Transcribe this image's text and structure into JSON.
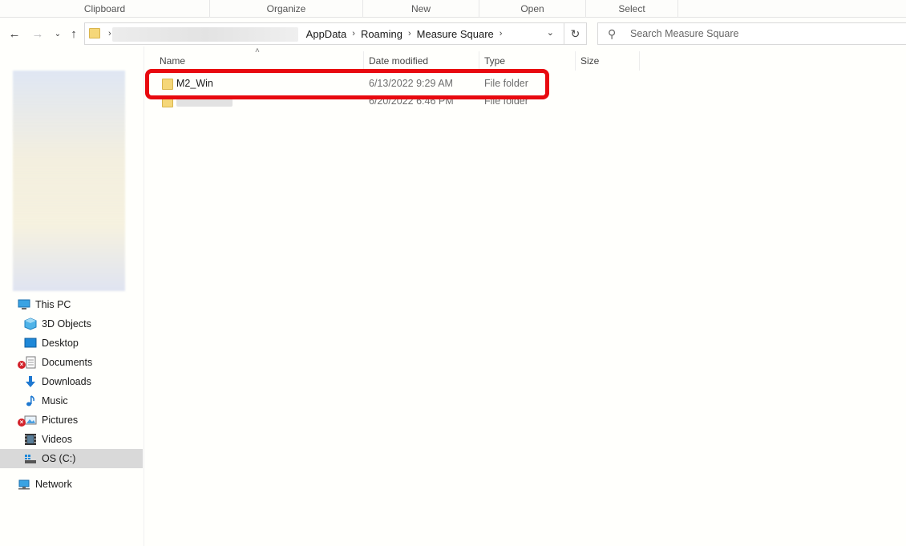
{
  "ribbon": {
    "groups": [
      "Clipboard",
      "Organize",
      "New",
      "Open",
      "Select"
    ]
  },
  "address": {
    "segments": [
      "AppData",
      "Roaming",
      "Measure Square"
    ]
  },
  "search": {
    "placeholder": "Search Measure Square"
  },
  "columns": [
    "Name",
    "Date modified",
    "Type",
    "Size"
  ],
  "files": [
    {
      "name": "M2_Win",
      "date": "6/13/2022 9:29 AM",
      "type": "File folder"
    },
    {
      "name": "",
      "date": "6/20/2022 6:46 PM",
      "type": "File folder"
    }
  ],
  "nav": {
    "this_pc": "This PC",
    "items": [
      "3D Objects",
      "Desktop",
      "Documents",
      "Downloads",
      "Music",
      "Pictures",
      "Videos",
      "OS (C:)"
    ],
    "network": "Network"
  },
  "icons": {
    "back": "arrow-left-icon",
    "forward": "arrow-right-icon",
    "up": "arrow-up-icon",
    "refresh": "refresh-icon",
    "search": "search-icon"
  },
  "colors": {
    "highlight": "#e8090f",
    "folder": "#f5d779",
    "selected_nav": "#d9d9d9"
  }
}
